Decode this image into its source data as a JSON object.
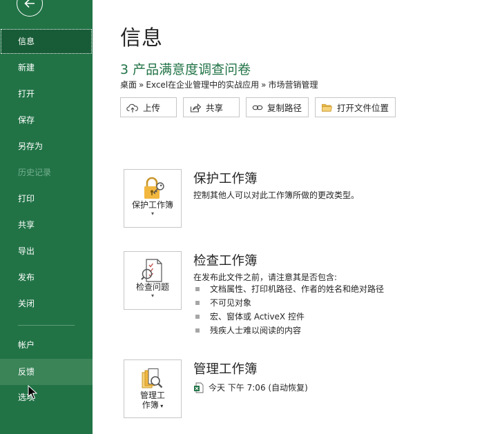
{
  "sidebar": {
    "items": [
      {
        "label": "信息",
        "state": "active"
      },
      {
        "label": "新建",
        "state": "normal"
      },
      {
        "label": "打开",
        "state": "normal"
      },
      {
        "label": "保存",
        "state": "normal"
      },
      {
        "label": "另存为",
        "state": "normal"
      },
      {
        "label": "历史记录",
        "state": "disabled"
      },
      {
        "label": "打印",
        "state": "normal"
      },
      {
        "label": "共享",
        "state": "normal"
      },
      {
        "label": "导出",
        "state": "normal"
      },
      {
        "label": "发布",
        "state": "normal"
      },
      {
        "label": "关闭",
        "state": "normal"
      },
      {
        "label": "帐户",
        "state": "normal"
      },
      {
        "label": "反馈",
        "state": "hover"
      },
      {
        "label": "选项",
        "state": "normal"
      }
    ]
  },
  "main": {
    "page_title": "信息",
    "doc_title": "3 产品满意度调查问卷",
    "breadcrumb": [
      "桌面",
      "Excel在企业管理中的实战应用",
      "市场营销管理"
    ],
    "breadcrumb_sep": "»",
    "actions": [
      {
        "label": "上传",
        "icon": "upload-cloud-icon"
      },
      {
        "label": "共享",
        "icon": "share-arrow-icon"
      },
      {
        "label": "复制路径",
        "icon": "link-icon"
      },
      {
        "label": "打开文件位置",
        "icon": "folder-icon"
      }
    ],
    "protect": {
      "card_label": "保护工作簿",
      "title": "保护工作簿",
      "desc": "控制其他人可以对此工作簿所做的更改类型。"
    },
    "inspect": {
      "card_label": "检查问题",
      "title": "检查工作簿",
      "desc": "在发布此文件之前，请注意其是否包含:",
      "bullets": [
        "文档属性、打印机路径、作者的姓名和绝对路径",
        "不可见对象",
        "宏、窗体或 ActiveX 控件",
        "残疾人士难以阅读的内容"
      ]
    },
    "manage": {
      "card_label_1": "管理工",
      "card_label_2": "作簿",
      "title": "管理工作簿",
      "version": "今天 下午 7:06 (自动恢复)"
    }
  },
  "colors": {
    "brand": "#217346",
    "active": "#185c37",
    "hover": "#3a8458"
  }
}
